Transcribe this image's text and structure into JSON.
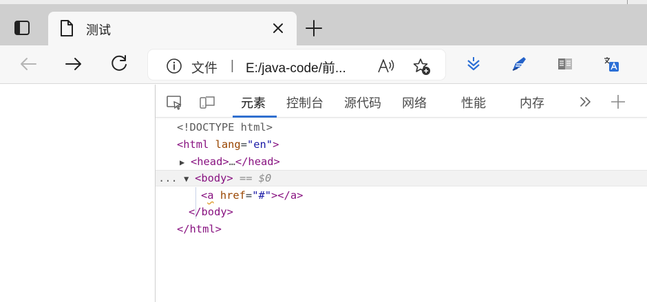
{
  "tab": {
    "title": "测试"
  },
  "address": {
    "label": "文件",
    "separator": "|",
    "url": "E:/java-code/前..."
  },
  "devtools": {
    "tabs": [
      "元素",
      "控制台",
      "源代码",
      "网络",
      "性能",
      "内存"
    ],
    "active_tab": "元素",
    "dom_lines": {
      "doctype": "<!DOCTYPE html>",
      "html_open_tag": "<html",
      "html_attr": "lang",
      "html_attr_value": "\"en\"",
      "html_close_bracket": ">",
      "head": "<head>",
      "head_ellipsis": "…",
      "head_close": "</head>",
      "body": "<body>",
      "body_eq": "== $0",
      "ellipsis_dots": "...",
      "a_open": "<",
      "a_name": "a",
      "a_attr": "href",
      "a_attr_value": "\"#\"",
      "a_rest": "></a>",
      "body_close": "</body>",
      "html_close": "</html>"
    }
  },
  "colors": {
    "accent": "#2f6fcf",
    "tag": "#881280",
    "attr": "#994500",
    "value": "#1a1aa6"
  }
}
